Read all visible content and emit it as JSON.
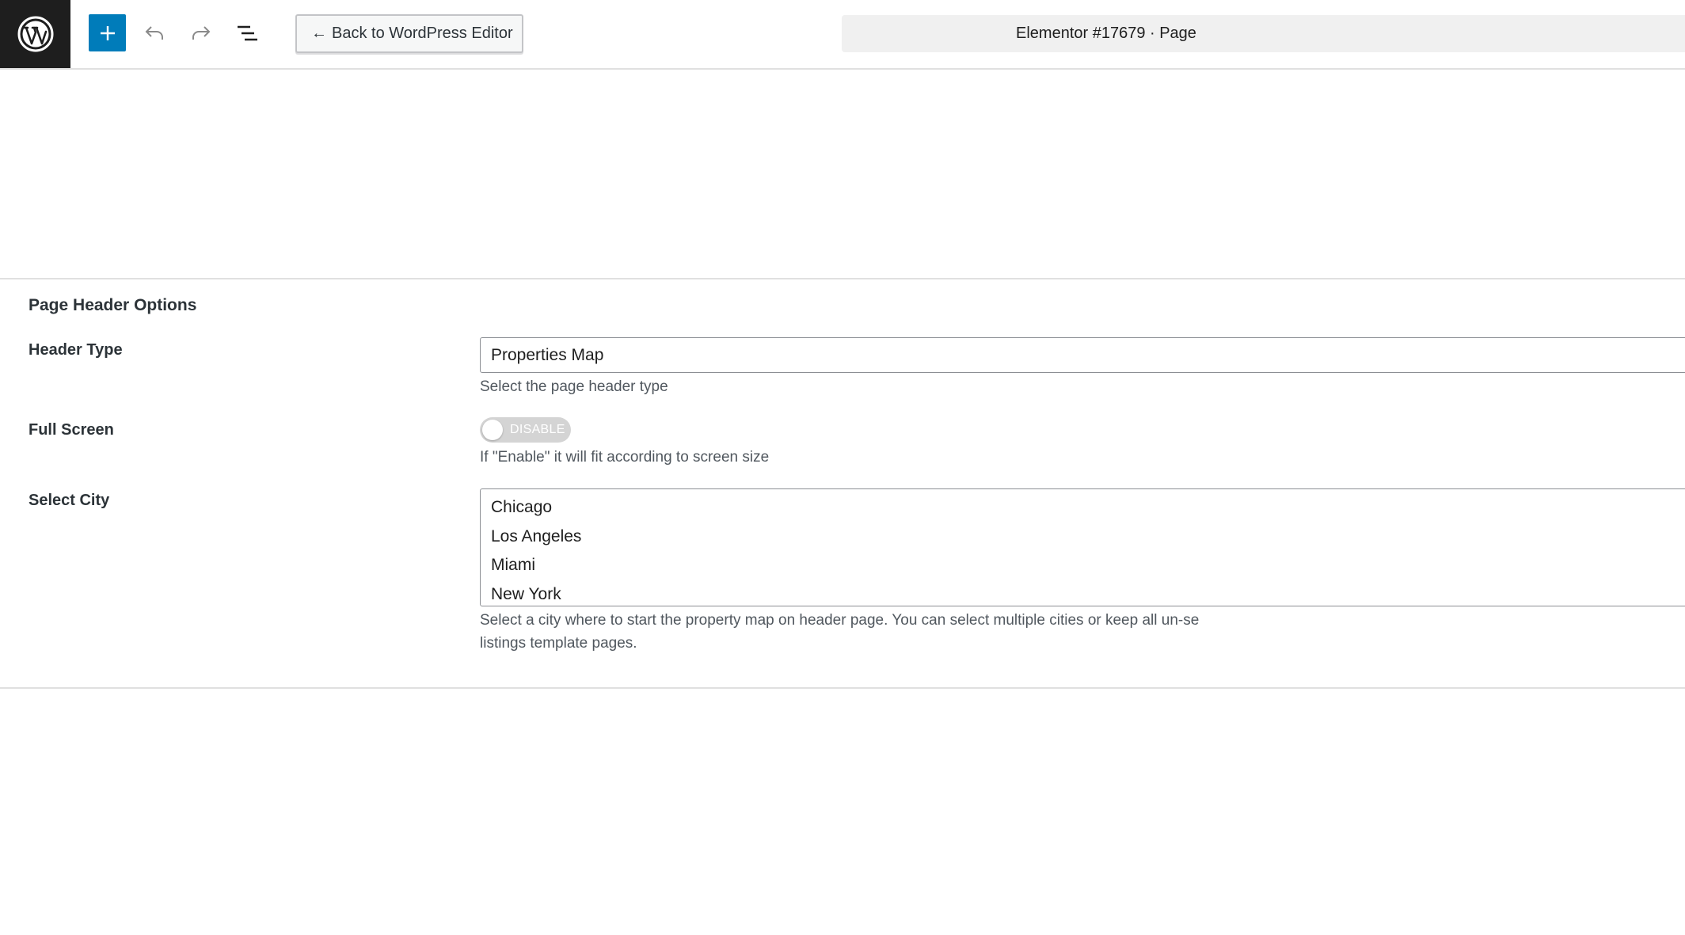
{
  "toolbar": {
    "back_label": "Back to WordPress Editor",
    "back_arrow": "←",
    "document_title": "Elementor #17679 · Page",
    "icons": [
      "wordpress-logo-icon",
      "plus-icon",
      "undo-icon",
      "redo-icon",
      "list-view-icon",
      "arrow-left-icon"
    ]
  },
  "section": {
    "title": "Page Header Options"
  },
  "fields": {
    "header_type": {
      "label": "Header Type",
      "value": "Properties Map",
      "help": "Select the page header type"
    },
    "full_screen": {
      "label": "Full Screen",
      "toggle_text": "DISABLE",
      "help": "If \"Enable\" it will fit according to screen size"
    },
    "select_city": {
      "label": "Select City",
      "options": [
        "Chicago",
        "Los Angeles",
        "Miami",
        "New York"
      ],
      "help_line1": "Select a city where to start the property map on header page. You can select multiple cities or keep all un-se",
      "help_line2": "listings template pages."
    }
  },
  "colors": {
    "accent": "#007cba",
    "logo_bg": "#1e1e1e",
    "toggle_off": "#d4d4d4"
  }
}
